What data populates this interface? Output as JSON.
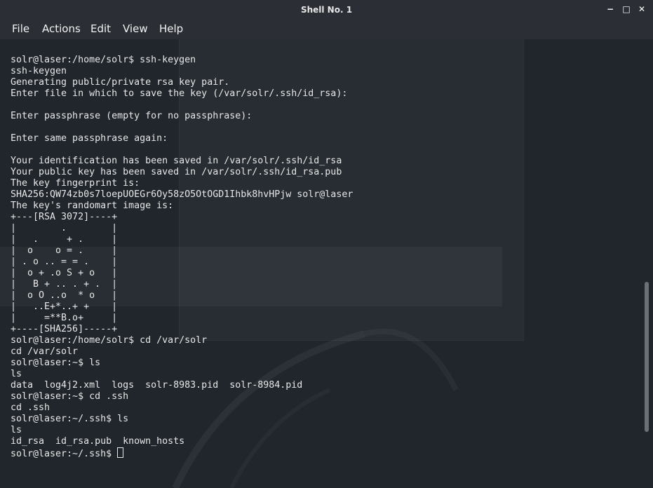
{
  "window": {
    "title": "Shell No. 1",
    "controls": {
      "minimize": "−",
      "maximize": "□",
      "close": "✕"
    }
  },
  "menu": [
    "File",
    "Actions",
    "Edit",
    "View",
    "Help"
  ],
  "terminal": {
    "lines": [
      "solr@laser:/home/solr$ ssh-keygen",
      "ssh-keygen",
      "Generating public/private rsa key pair.",
      "Enter file in which to save the key (/var/solr/.ssh/id_rsa):",
      "",
      "Enter passphrase (empty for no passphrase):",
      "",
      "Enter same passphrase again:",
      "",
      "Your identification has been saved in /var/solr/.ssh/id_rsa",
      "Your public key has been saved in /var/solr/.ssh/id_rsa.pub",
      "The key fingerprint is:",
      "SHA256:QW74zb0s7loepUOEGr6Oy58zO5OtOGD1Ihbk8hvHPjw solr@laser",
      "The key's randomart image is:",
      "+---[RSA 3072]----+",
      "|        .        |",
      "|   .     + .     |",
      "|  o    o = .     |",
      "| . o .. = = .    |",
      "|  o + .o S + o   |",
      "|   B + .. . + .  |",
      "|  o O ..o  * o   |",
      "|   ..E+*..+ +    |",
      "|     =**B.o+     |",
      "+----[SHA256]-----+",
      "solr@laser:/home/solr$ cd /var/solr",
      "cd /var/solr",
      "solr@laser:~$ ls",
      "ls",
      "data  log4j2.xml  logs  solr-8983.pid  solr-8984.pid",
      "solr@laser:~$ cd .ssh",
      "cd .ssh",
      "solr@laser:~/.ssh$ ls",
      "ls",
      "id_rsa  id_rsa.pub  known_hosts"
    ],
    "prompt": "solr@laser:~/.ssh$ "
  },
  "colors": {
    "background": "#20262c",
    "titlebar": "#2b2f35",
    "text": "#e8e8e8",
    "scrollbar": "#6b7078"
  }
}
